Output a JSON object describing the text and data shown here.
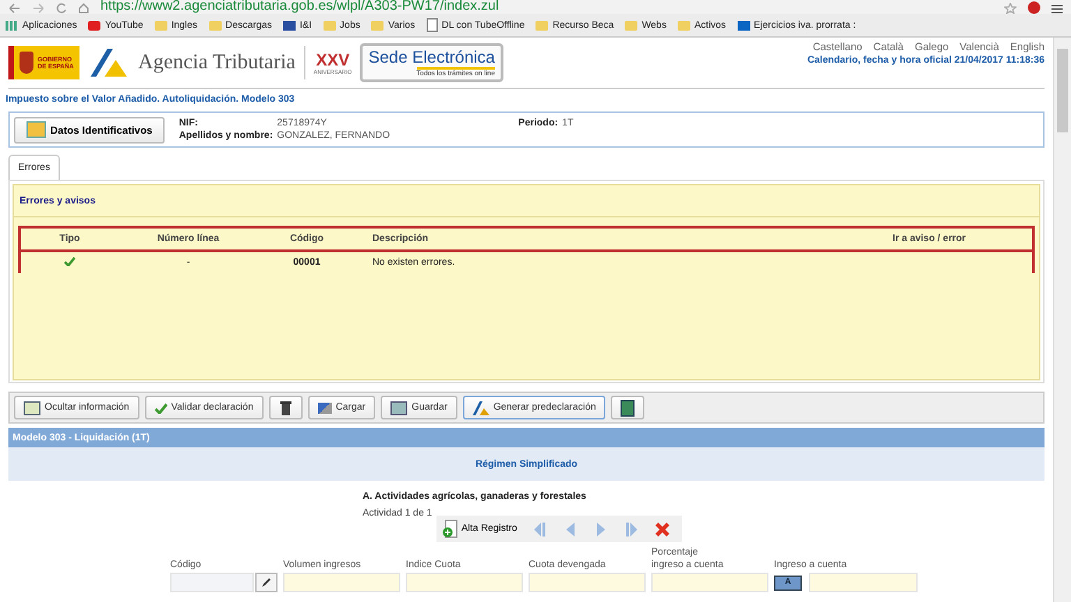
{
  "browser": {
    "url": "https://www2.agenciatributaria.gob.es/wlpl/A303-PW17/index.zul",
    "bookmarks": [
      {
        "label": "Aplicaciones",
        "kind": "apps"
      },
      {
        "label": "YouTube",
        "kind": "video"
      },
      {
        "label": "Ingles",
        "kind": "folder"
      },
      {
        "label": "Descargas",
        "kind": "folder"
      },
      {
        "label": "I&I",
        "kind": "square"
      },
      {
        "label": "Jobs",
        "kind": "folder"
      },
      {
        "label": "Varios",
        "kind": "folder"
      },
      {
        "label": "DL con TubeOffline",
        "kind": "page"
      },
      {
        "label": "Recurso Beca",
        "kind": "folder"
      },
      {
        "label": "Webs",
        "kind": "folder"
      },
      {
        "label": "Activos",
        "kind": "folder"
      },
      {
        "label": "Ejercicios iva. prorrata :",
        "kind": "linkedin"
      }
    ]
  },
  "header": {
    "government": "GOBIERNO DE ESPAÑA",
    "agency": "Agencia Tributaria",
    "anniversary": "XXV",
    "anniversary_caption": "ANIVERSARIO",
    "sede": "Sede Electrónica",
    "sede_caption": "Todos los trámites on line",
    "languages": [
      "Castellano",
      "Català",
      "Galego",
      "Valencià",
      "English"
    ],
    "clock": "Calendario, fecha y hora oficial 21/04/2017 11:18:36"
  },
  "page_title": "Impuesto sobre el Valor Añadido. Autoliquidación. Modelo 303",
  "taxpayer": {
    "button": "Datos Identificativos",
    "nif_label": "NIF:",
    "nif": "25718974Y",
    "period_label": "Periodo:",
    "period": "1T",
    "name_label": "Apellidos y nombre:",
    "name": "GONZALEZ, FERNANDO"
  },
  "tabs": [
    {
      "label": "Errores",
      "selected": true
    }
  ],
  "errors": {
    "title": "Errores y avisos",
    "columns": [
      "Tipo",
      "Número línea",
      "Código",
      "Descripción",
      "Ir a aviso / error"
    ],
    "rows": [
      {
        "kind": "ok",
        "line": "-",
        "code": "00001",
        "description": "No existen errores."
      }
    ]
  },
  "toolbar": [
    {
      "kind": "panel",
      "label": "Ocultar información",
      "focused": false
    },
    {
      "kind": "check",
      "label": "Validar declaración",
      "focused": false
    },
    {
      "kind": "trash",
      "focused": false
    },
    {
      "kind": "load",
      "label": "Cargar",
      "focused": false
    },
    {
      "kind": "save",
      "label": "Guardar",
      "focused": false
    },
    {
      "kind": "generate",
      "label": "Generar predeclaración",
      "focused": true
    },
    {
      "kind": "calc",
      "focused": false
    }
  ],
  "section": {
    "title": "Modelo 303 - Liquidación (1T)",
    "regime": "Régimen Simplificado",
    "subsection": "A. Actividades agrícolas, ganaderas y forestales",
    "counter": "Actividad 1 de 1",
    "add": "Alta Registro",
    "nav": [
      {
        "kind": "first",
        "disabled": true
      },
      {
        "kind": "prev",
        "disabled": true
      },
      {
        "kind": "next",
        "disabled": true
      },
      {
        "kind": "last",
        "disabled": true
      },
      {
        "kind": "delete",
        "disabled": false
      }
    ],
    "fields": [
      {
        "kind": "code",
        "label": "Código"
      },
      {
        "kind": "plain",
        "label": "Volumen ingresos"
      },
      {
        "kind": "plain",
        "label": "Indice Cuota"
      },
      {
        "kind": "plain",
        "label": "Cuota devengada"
      },
      {
        "kind": "plain",
        "label": "Porcentaje\ningreso a cuenta"
      },
      {
        "kind": "badge",
        "label": "Ingreso a cuenta",
        "badge": "A"
      }
    ]
  }
}
